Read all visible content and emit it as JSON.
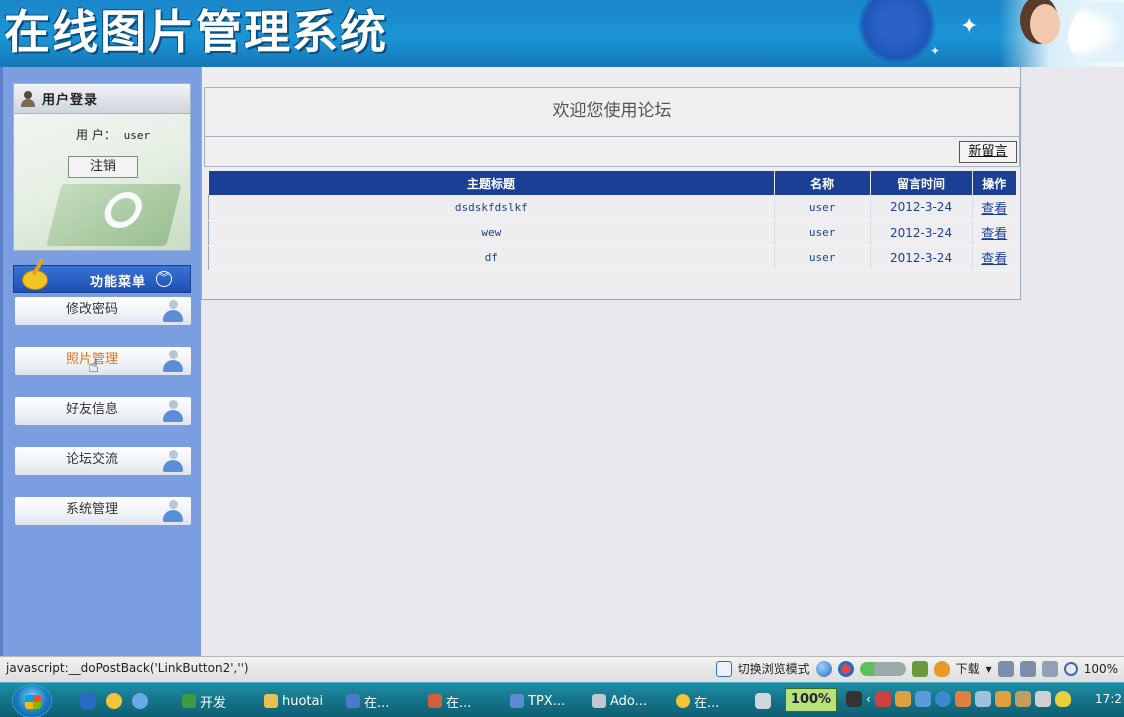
{
  "banner": {
    "title": "在线图片管理系统"
  },
  "login": {
    "header_title": "用户登录",
    "user_label": "用 户：",
    "user_value": "user",
    "logout_label": "注销"
  },
  "menu": {
    "header_title": "功能菜单",
    "toggle_symbol": "»",
    "items": [
      {
        "label": "修改密码",
        "active": false
      },
      {
        "label": "照片管理",
        "active": true
      },
      {
        "label": "好友信息",
        "active": false
      },
      {
        "label": "论坛交流",
        "active": false
      },
      {
        "label": "系统管理",
        "active": false
      }
    ]
  },
  "main": {
    "welcome_text": "欢迎您使用论坛",
    "new_message_label": "新留言",
    "table": {
      "headers": [
        "主题标题",
        "名称",
        "留言时间",
        "操作"
      ],
      "rows": [
        {
          "title": "dsdskfdslkf",
          "name": "user",
          "time": "2012-3-24",
          "action": "查看"
        },
        {
          "title": "wew",
          "name": "user",
          "time": "2012-3-24",
          "action": "查看"
        },
        {
          "title": "df",
          "name": "user",
          "time": "2012-3-24",
          "action": "查看"
        }
      ]
    }
  },
  "statusbar": {
    "text": "javascript:__doPostBack('LinkButton2','')",
    "mode_label": "切换浏览模式",
    "download_label": "下载",
    "zoom_label": "100%"
  },
  "taskbar": {
    "items": [
      {
        "label": "开发",
        "icon": "tree-icon",
        "color": "#3f9b3f"
      },
      {
        "label": "huotai",
        "icon": "folder-icon",
        "color": "#e8c050"
      },
      {
        "label": "在...",
        "icon": "document-icon",
        "color": "#4a7ac8"
      },
      {
        "label": "在...",
        "icon": "paint-icon",
        "color": "#d0603a"
      },
      {
        "label": "TPX...",
        "icon": "window-icon",
        "color": "#5a8ad0"
      },
      {
        "label": "Ado...",
        "icon": "adobe-icon",
        "color": "#c0c8d0"
      },
      {
        "label": "在...",
        "icon": "ie-icon",
        "color": "#f2c43a"
      }
    ],
    "zoom_box": "100%",
    "clock": "17:2"
  }
}
